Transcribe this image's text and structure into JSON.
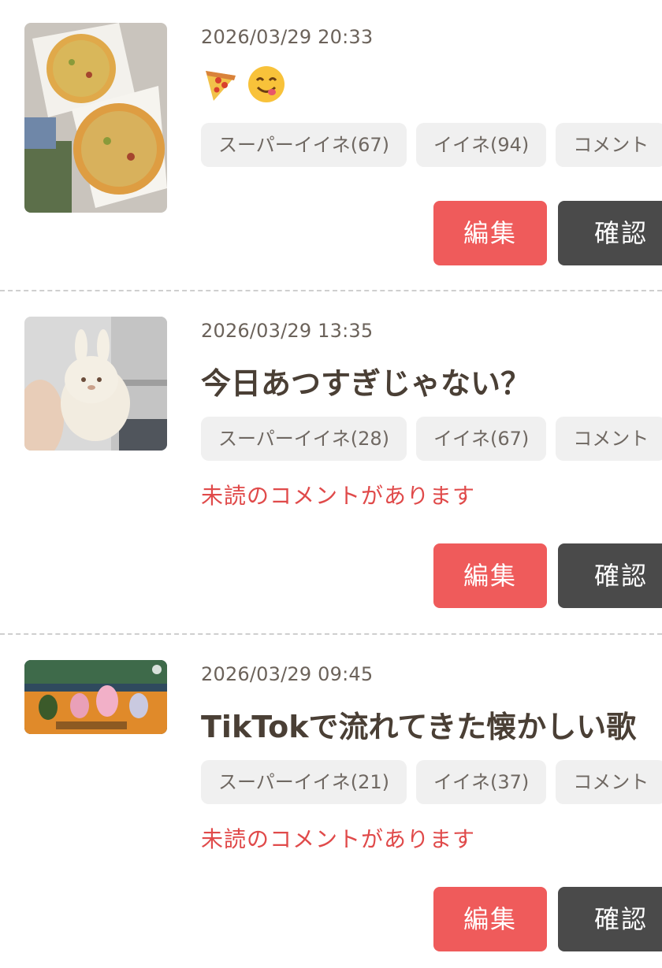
{
  "posts": [
    {
      "timestamp": "2026/03/29 20:33",
      "title": "",
      "emojis": [
        "pizza-icon",
        "yum-face-icon"
      ],
      "reactions": {
        "super_like": "スーパーイイネ(67)",
        "like": "イイネ(94)",
        "comment": "コメント"
      },
      "unread": "",
      "edit_label": "編集",
      "check_label": "確認"
    },
    {
      "timestamp": "2026/03/29 13:35",
      "title": "今日あつすぎじゃない？",
      "reactions": {
        "super_like": "スーパーイイネ(28)",
        "like": "イイネ(67)",
        "comment": "コメント"
      },
      "unread": "未読のコメントがあります",
      "edit_label": "編集",
      "check_label": "確認"
    },
    {
      "timestamp": "2026/03/29 09:45",
      "title": "TikTokで流れてきた懐かしい歌",
      "reactions": {
        "super_like": "スーパーイイネ(21)",
        "like": "イイネ(37)",
        "comment": "コメント"
      },
      "unread": "未読のコメントがあります",
      "edit_label": "編集",
      "check_label": "確認"
    }
  ],
  "colors": {
    "edit_button": "#ef5b5b",
    "check_button": "#4a4a4a",
    "unread_text": "#e04a4a",
    "chip_bg": "#f0f0f0"
  }
}
